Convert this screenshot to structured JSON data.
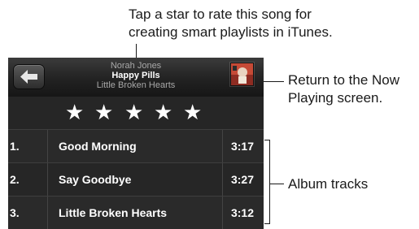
{
  "callouts": {
    "rate_line1": "Tap a star to rate this song for",
    "rate_line2": "creating smart playlists in iTunes.",
    "return_line1": "Return to the Now",
    "return_line2": "Playing screen.",
    "tracks_label": "Album tracks"
  },
  "now_playing": {
    "artist": "Norah Jones",
    "song": "Happy Pills",
    "album": "Little Broken Hearts"
  },
  "icons": {
    "back": "back-arrow-icon",
    "album_art": "album-art-thumbnail",
    "star": "star-icon"
  },
  "rating": {
    "stars": [
      "★",
      "★",
      "★",
      "★",
      "★"
    ]
  },
  "tracks": [
    {
      "number": "1.",
      "title": "Good Morning",
      "duration": "3:17"
    },
    {
      "number": "2.",
      "title": "Say Goodbye",
      "duration": "3:27"
    },
    {
      "number": "3.",
      "title": "Little Broken Hearts",
      "duration": "3:12"
    }
  ],
  "colors": {
    "panel_background": "#1c1c1c",
    "text_primary": "#ffffff",
    "text_secondary": "#a8a8a8",
    "album_art_accent": "#b23a2e"
  }
}
